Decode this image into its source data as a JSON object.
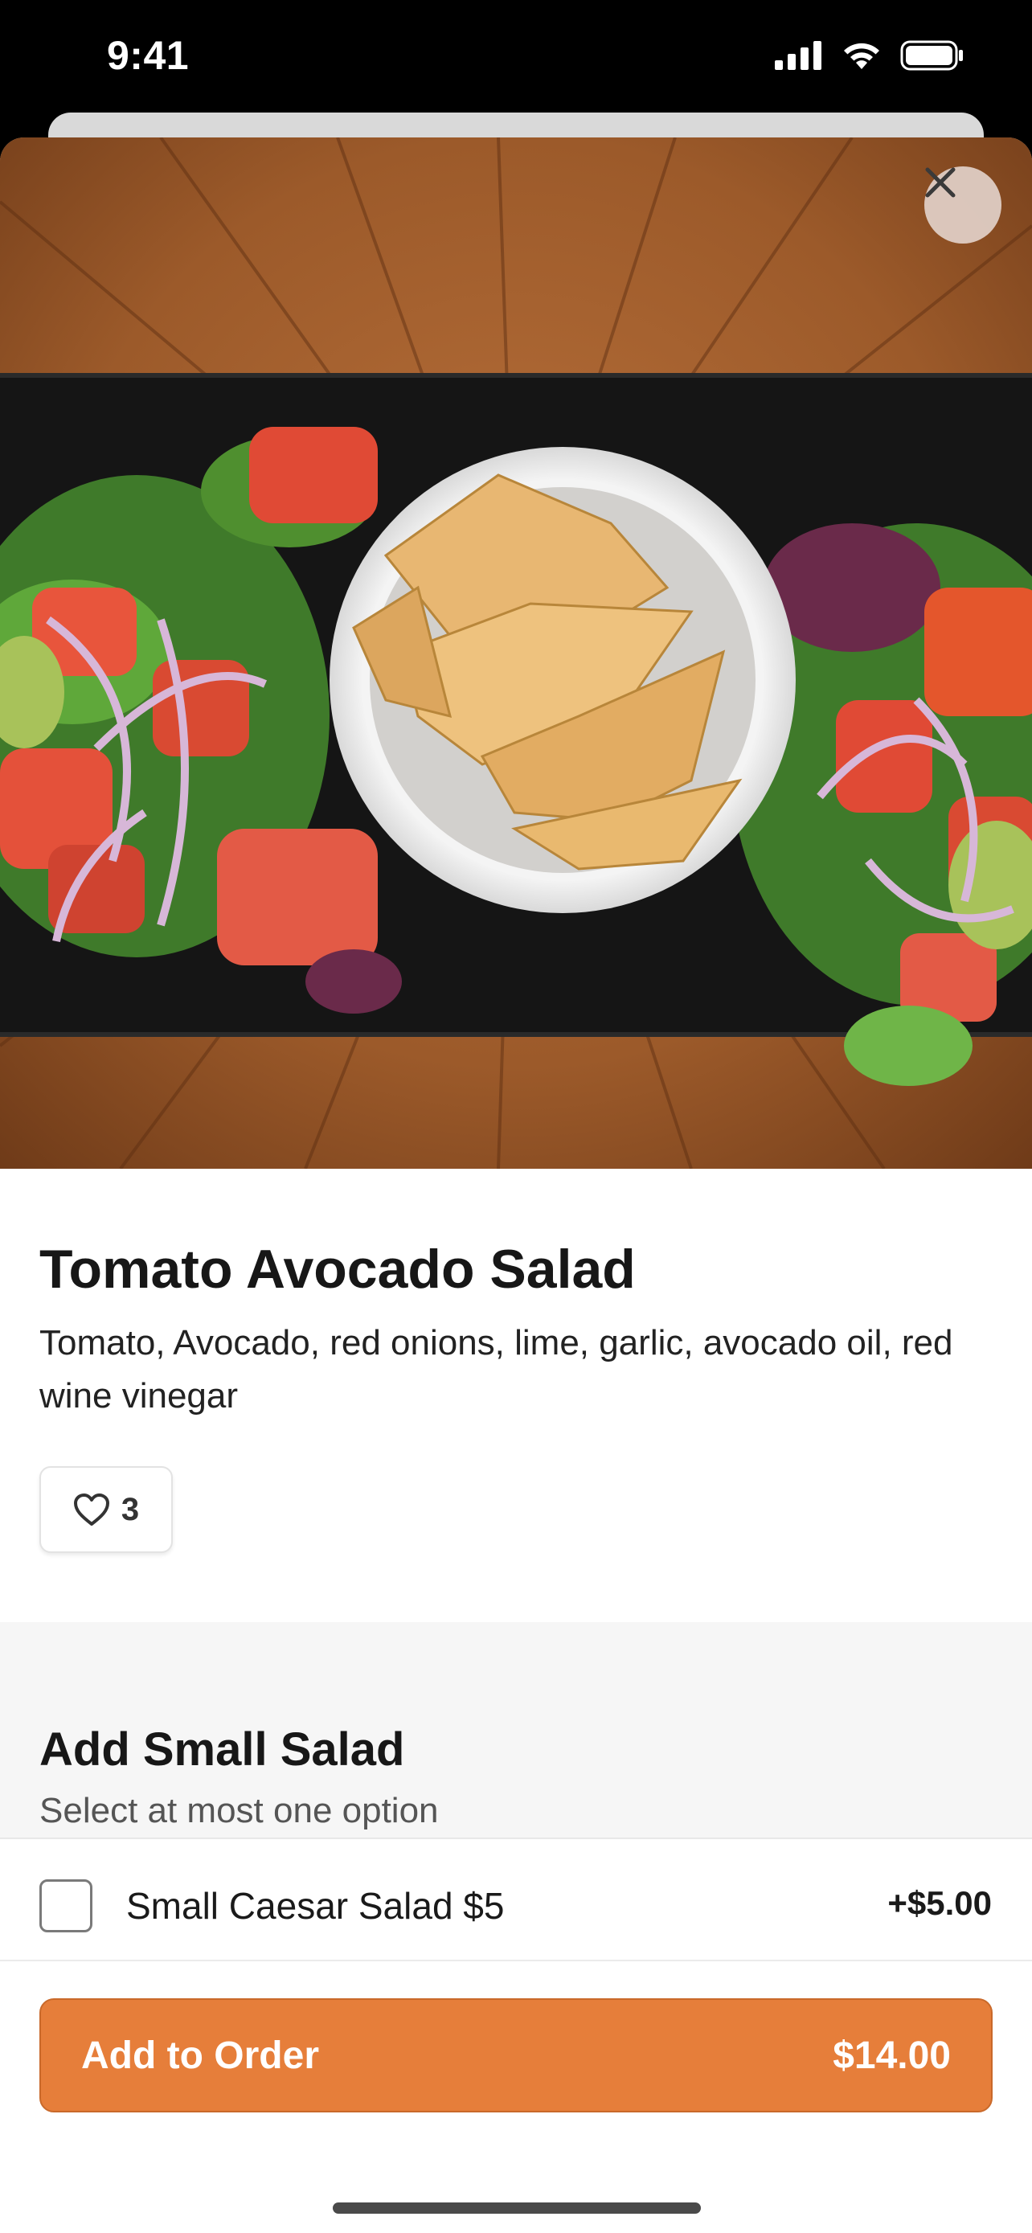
{
  "status_bar": {
    "time": "9:41",
    "icons": [
      "cellular-signal-icon",
      "wifi-icon",
      "battery-icon"
    ]
  },
  "hero": {
    "image_description": "",
    "close_icon": "close-icon"
  },
  "item": {
    "title": "Tomato Avocado Salad",
    "description": "Tomato, Avocado, red onions, lime, garlic, avocado oil, red wine vinegar",
    "likes": "3",
    "like_icon": "heart-icon"
  },
  "option_group": {
    "title": "Add Small Salad",
    "subtitle": "Select at most one option",
    "options": [
      {
        "label": "Small Caesar Salad $5",
        "price": "+$5.00",
        "checked": false
      }
    ]
  },
  "footer": {
    "button_label": "Add to Order",
    "button_price": "$14.00"
  },
  "colors": {
    "accent": "#e67e3a",
    "options_bg": "#f6f6f6",
    "background": "#ffffff"
  }
}
